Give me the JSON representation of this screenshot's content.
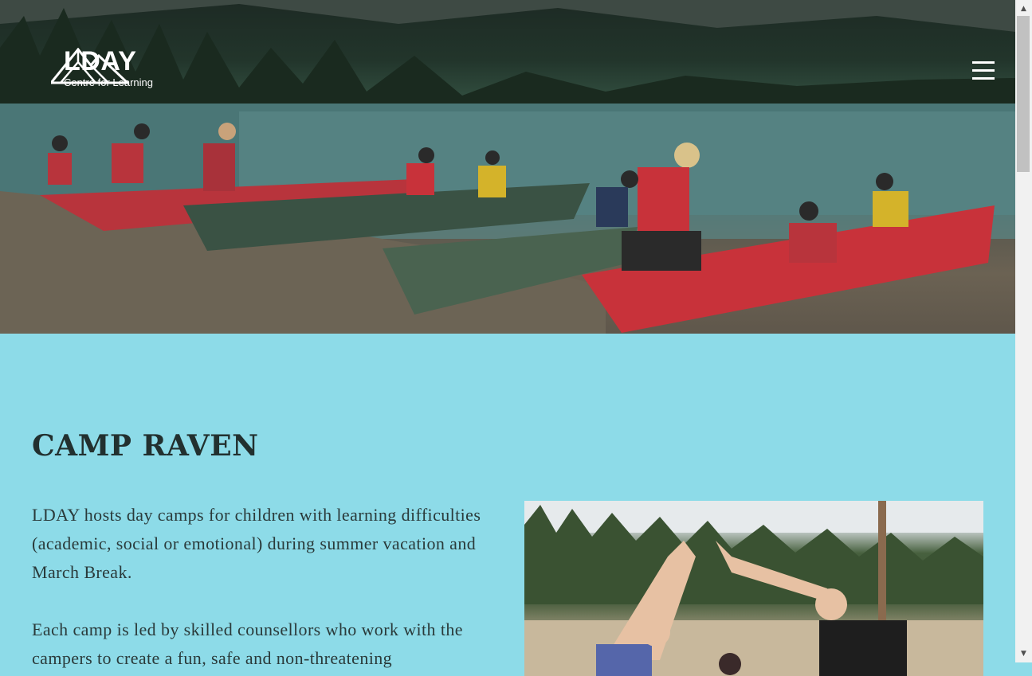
{
  "header": {
    "logo_title": "LDAY",
    "logo_subtitle": "Centre for Learning",
    "menu_icon": "hamburger-menu-icon"
  },
  "main": {
    "title": "CAMP RAVEN",
    "paragraphs": [
      "LDAY hosts day camps for children with learning difficulties (academic, social or emotional) during summer vacation and March Break.",
      "Each camp is led by skilled counsellors who work with the campers to create a fun, safe and non-threatening"
    ]
  },
  "colors": {
    "background": "#8ddbe8",
    "text": "#2a3a3a",
    "canoe_red": "#c8323a",
    "canoe_green": "#3f5a4a"
  }
}
